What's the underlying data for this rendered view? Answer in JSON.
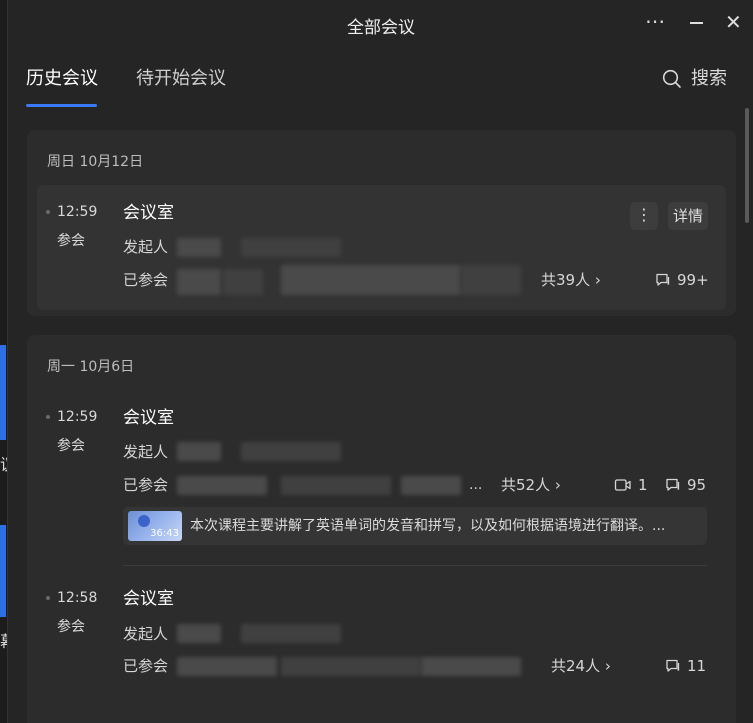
{
  "window": {
    "title": "全部会议",
    "more_icon": "⋯",
    "close_icon": "✕"
  },
  "background_app": {
    "char_1": "议",
    "char_2": "幕"
  },
  "tabs": [
    {
      "label": "历史会议",
      "active": true
    },
    {
      "label": "待开始会议",
      "active": false
    }
  ],
  "search": {
    "label": "搜索",
    "icon": "search-icon"
  },
  "accent_color": "#3a7bf5",
  "groups": [
    {
      "date": "周日 10月12日",
      "meetings": [
        {
          "time": "12:59",
          "status": "参会",
          "title": "会议室",
          "initiator_label": "发起人",
          "participants_label": "已参会",
          "participants_count": "共39人",
          "chat_count": "99+",
          "more_label": "⋮",
          "detail_label": "详情"
        }
      ]
    },
    {
      "date": "周一 10月6日",
      "meetings": [
        {
          "time": "12:59",
          "status": "参会",
          "title": "会议室",
          "initiator_label": "发起人",
          "participants_label": "已参会",
          "participants_ellipsis": "...",
          "participants_count": "共52人",
          "recording_count": "1",
          "chat_count": "95",
          "summary": {
            "duration": "36:43",
            "text": "本次课程主要讲解了英语单词的发音和拼写，以及如何根据语境进行翻译。..."
          }
        },
        {
          "time": "12:58",
          "status": "参会",
          "title": "会议室",
          "initiator_label": "发起人",
          "participants_label": "已参会",
          "participants_count": "共24人",
          "chat_count": "11"
        }
      ]
    }
  ]
}
